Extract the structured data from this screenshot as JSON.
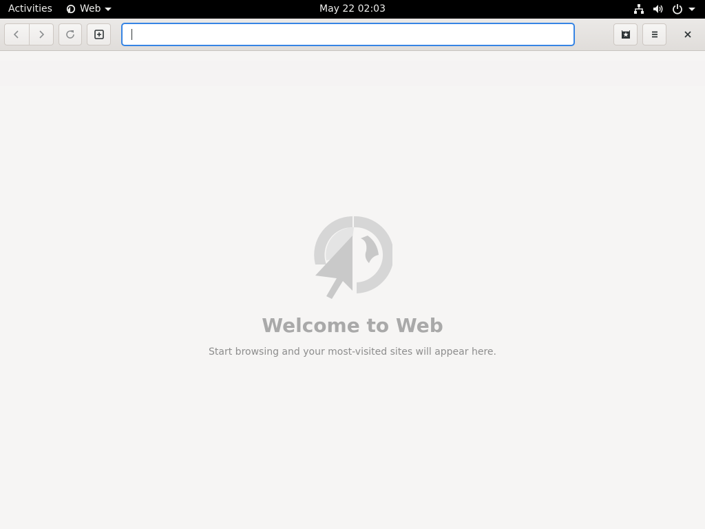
{
  "topbar": {
    "activities_label": "Activities",
    "app_name": "Web",
    "clock": "May 22  02:03",
    "tray_icons": [
      "network-wired-icon",
      "volume-icon",
      "power-icon",
      "chevron-down-icon"
    ]
  },
  "headerbar": {
    "back_icon": "go-back-icon",
    "forward_icon": "go-forward-icon",
    "reload_icon": "reload-icon",
    "new_tab_icon": "new-tab-icon",
    "url_value": "",
    "url_placeholder": "",
    "bookmarks_icon": "bookmark-star-icon",
    "menu_icon": "hamburger-menu-icon",
    "close_icon": "close-icon"
  },
  "main": {
    "title": "Welcome to Web",
    "subtitle": "Start browsing and your most-visited sites will appear here."
  },
  "colors": {
    "accent": "#3584e4",
    "topbar_bg": "#000000",
    "page_bg": "#f6f5f4",
    "welcome_text": "#a9a9a9"
  }
}
